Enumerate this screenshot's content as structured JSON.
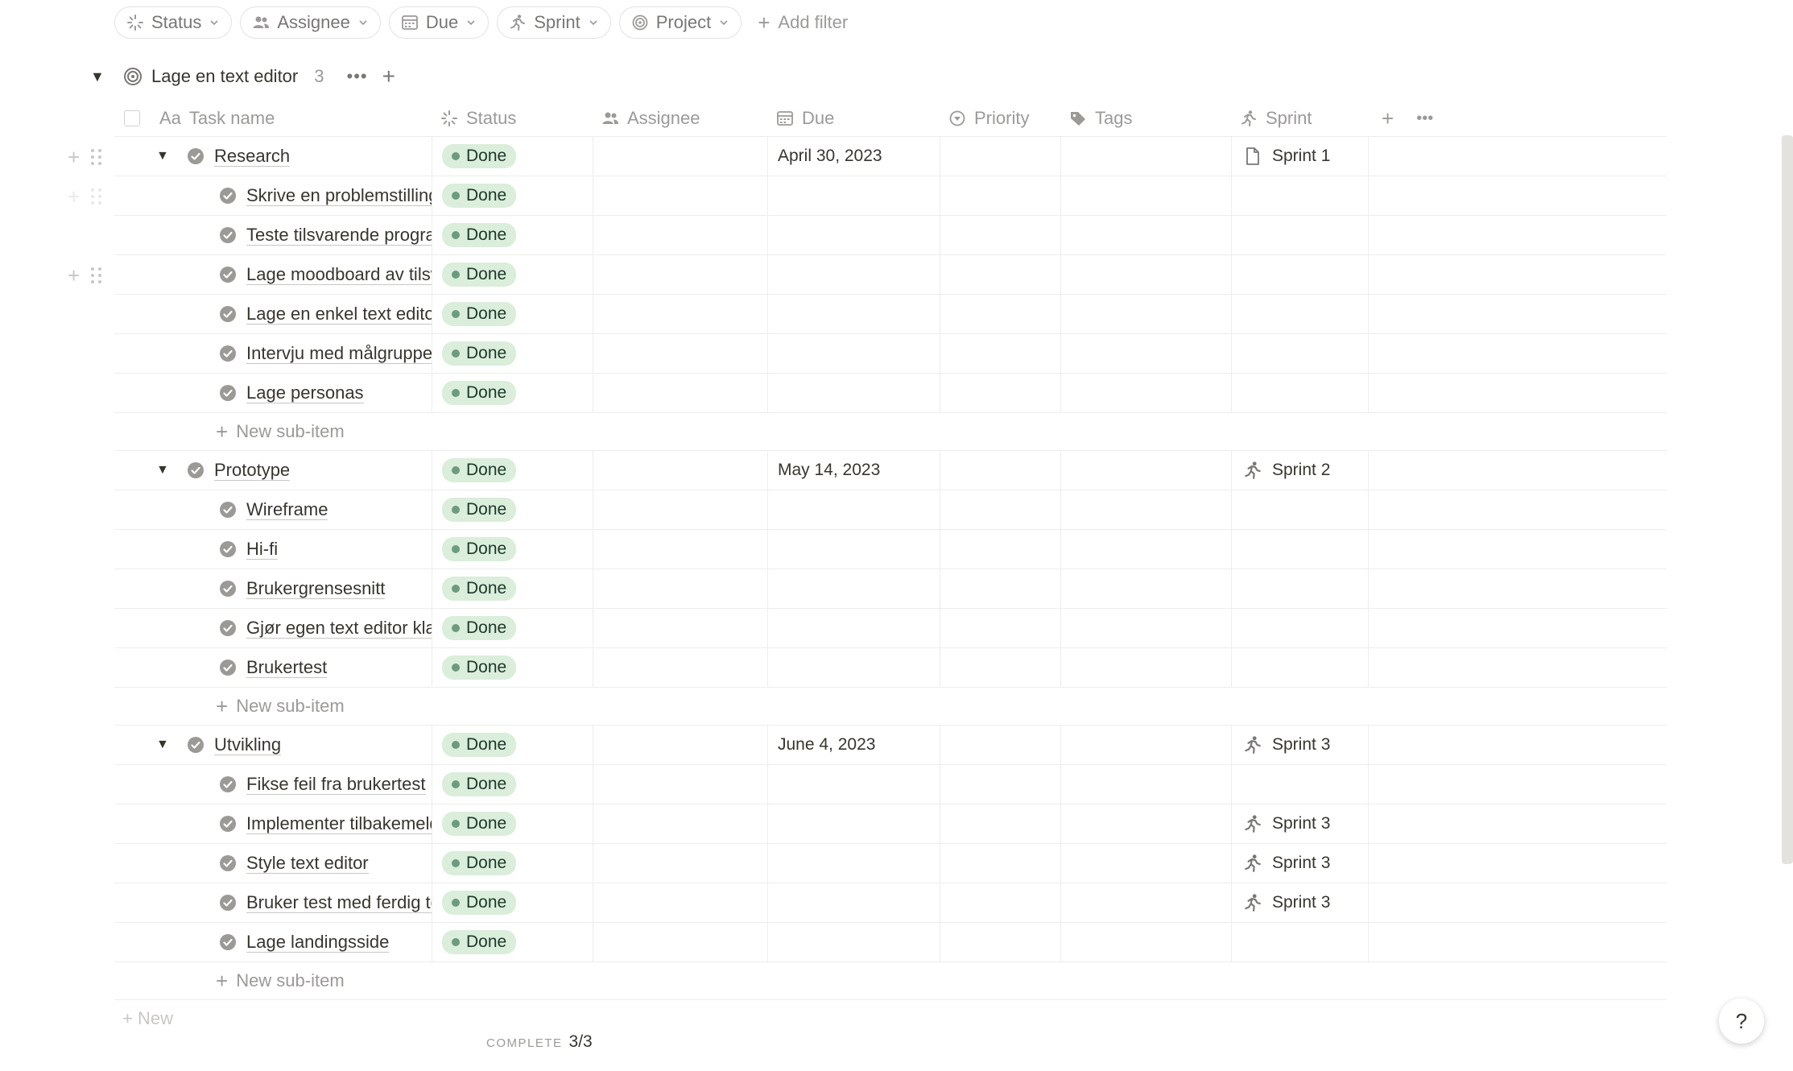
{
  "filters": [
    {
      "label": "Status",
      "icon": "status-icon"
    },
    {
      "label": "Assignee",
      "icon": "people-icon"
    },
    {
      "label": "Due",
      "icon": "calendar-icon"
    },
    {
      "label": "Sprint",
      "icon": "runner-icon"
    },
    {
      "label": "Project",
      "icon": "target-icon"
    }
  ],
  "add_filter_label": "Add filter",
  "group": {
    "title": "Lage en text editor",
    "count": "3",
    "more": "•••",
    "add": "+"
  },
  "columns": {
    "name": "Task name",
    "name_prefix": "Aa",
    "status": "Status",
    "assignee": "Assignee",
    "due": "Due",
    "priority": "Priority",
    "tags": "Tags",
    "sprint": "Sprint"
  },
  "head_tools": {
    "add": "+",
    "more": "•••"
  },
  "status_color": "#dbeddb",
  "status_dot_color": "#6c9b7d",
  "new_sub_item_label": "New sub-item",
  "rows": {
    "research": {
      "name": "Research",
      "status": "Done",
      "due": "April 30, 2023",
      "sprint": "Sprint 1"
    },
    "r1": {
      "name": "Skrive en problemstilling",
      "status": "Done"
    },
    "r2": {
      "name": "Teste tilsvarende program",
      "status": "Done"
    },
    "r3": {
      "name": "Lage moodboard av tilsvarende",
      "status": "Done"
    },
    "r4": {
      "name": "Lage en enkel text editor",
      "status": "Done"
    },
    "r5": {
      "name": "Intervju med målgruppe",
      "status": "Done"
    },
    "r6": {
      "name": "Lage personas",
      "status": "Done"
    },
    "prototype": {
      "name": "Prototype",
      "status": "Done",
      "due": "May 14, 2023",
      "sprint": "Sprint 2"
    },
    "p1": {
      "name": "Wireframe",
      "status": "Done"
    },
    "p2": {
      "name": "Hi-fi",
      "status": "Done"
    },
    "p3": {
      "name": "Brukergrensesnitt",
      "status": "Done"
    },
    "p4": {
      "name": "Gjør egen text editor klar",
      "status": "Done"
    },
    "p5": {
      "name": "Brukertest",
      "status": "Done"
    },
    "utvikling": {
      "name": "Utvikling",
      "status": "Done",
      "due": "June 4, 2023",
      "sprint": "Sprint 3"
    },
    "u1": {
      "name": "Fikse feil fra brukertest",
      "status": "Done"
    },
    "u2": {
      "name": "Implementer tilbakemeldinger",
      "status": "Done",
      "sprint": "Sprint 3"
    },
    "u3": {
      "name": "Style text editor",
      "status": "Done",
      "sprint": "Sprint 3"
    },
    "u4": {
      "name": "Bruker test med ferdig text editor",
      "status": "Done",
      "sprint": "Sprint 3"
    },
    "u5": {
      "name": "Lage landingsside",
      "status": "Done"
    }
  },
  "footer_new_label": "New",
  "calc": {
    "label": "COMPLETE",
    "value": "3/3"
  },
  "help_label": "?"
}
